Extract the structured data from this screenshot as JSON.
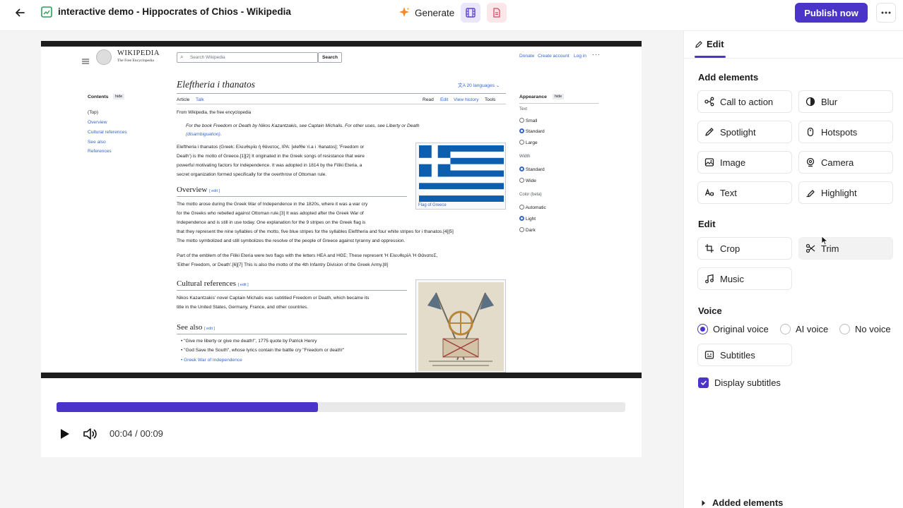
{
  "topbar": {
    "title": "interactive demo - Hippocrates of Chios - Wikipedia",
    "generate_label": "Generate",
    "publish_label": "Publish now",
    "accent": "#4b35c8"
  },
  "player": {
    "time": "00:04 / 00:09",
    "progress": 0.46
  },
  "panel": {
    "tab_label": "Edit",
    "add_elements_title": "Add elements",
    "add_elements": [
      {
        "label": "Call to action",
        "icon": "call-to-action-icon"
      },
      {
        "label": "Blur",
        "icon": "blur-icon"
      },
      {
        "label": "Spotlight",
        "icon": "spotlight-icon"
      },
      {
        "label": "Hotspots",
        "icon": "hotspots-icon"
      },
      {
        "label": "Image",
        "icon": "image-icon"
      },
      {
        "label": "Camera",
        "icon": "camera-icon"
      },
      {
        "label": "Text",
        "icon": "text-icon"
      },
      {
        "label": "Highlight",
        "icon": "highlight-icon"
      }
    ],
    "edit_title": "Edit",
    "edit_items": [
      {
        "label": "Crop",
        "icon": "crop-icon"
      },
      {
        "label": "Trim",
        "icon": "scissors-icon"
      },
      {
        "label": "Music",
        "icon": "music-icon"
      }
    ],
    "voice_title": "Voice",
    "voice_options": [
      "Original voice",
      "AI voice",
      "No voice"
    ],
    "voice_selected": "Original voice",
    "subtitles_label": "Subtitles",
    "display_subtitles_label": "Display subtitles",
    "display_subtitles_checked": true,
    "added_elements_label": "Added elements"
  },
  "wiki": {
    "logo_title": "WIKIPEDIA",
    "logo_sub": "The Free Encyclopedia",
    "search_placeholder": "Search Wikipedia",
    "search_button": "Search",
    "top_links": [
      "Donate",
      "Create account",
      "Log in"
    ],
    "contents_title": "Contents",
    "hide": "hide",
    "toc": [
      "(Top)",
      "Overview",
      "Cultural references",
      "See also",
      "References"
    ],
    "article_title": "Eleftheria i thanatos",
    "languages": "20 languages",
    "tabs_left": [
      "Article",
      "Talk"
    ],
    "tabs_right": [
      "Read",
      "Edit",
      "View history",
      "Tools"
    ],
    "from": "From Wikipedia, the free encyclopedia",
    "hatnote_1": "For the book Freedom or Death by Nikos Kazantzakis, see Captain Michalis. For other uses, see Liberty or Death",
    "hatnote_2": "(disambiguation).",
    "intro_lines": [
      "Eleftheria i thanatos (Greek: Ελευθερία ή θάνατος, IPA: [elefθeˈri.a i ˈθanatos]; 'Freedom or",
      "Death') is the motto of Greece.[1][2] It originated in the Greek songs of resistance that were",
      "powerful motivating factors for independence. It was adopted in 1814 by the Filiki Eteria, a",
      "secret organization formed specifically for the overthrow of Ottoman rule."
    ],
    "flag_caption": "Flag of Greece",
    "overview_h": "Overview",
    "edit_tag": "[ edit ]",
    "overview_lines": [
      "The motto arose during the Greek War of Independence in the 1820s, where it was a war cry",
      "for the Greeks who rebelled against Ottoman rule.[3] It was adopted after the Greek War of",
      "Independence and is still in use today. One explanation for the 9 stripes on the Greek flag is",
      "that they represent the nine syllables of the motto, five blue stripes for the syllables Eleftheria and four white stripes for i thanatos.[4][5]",
      "The motto symbolized and still symbolizes the resolve of the people of Greece against tyranny and oppression."
    ],
    "emblem_lines": [
      "Part of the emblem of the Filiki Eteria were two flags with the letters HEA and ΗΘΣ; These represent 'Η ΕλευθερίΑ 'Η ΘάνατοΣ,",
      "'Either Freedom, or Death'.[6][7] This is also the motto of the 4th Infantry Division of the Greek Army.[8]"
    ],
    "cultural_h": "Cultural references",
    "cultural_lines": [
      "Nikos Kazantzakis' novel Captain Michalis was subtitled Freedom or Death, which became its",
      "title in the United States, Germany, France, and other countries."
    ],
    "seealso_h": "See also",
    "seealso": [
      "\"Give me liberty or give me death!\", 1775 quote by Patrick Henry",
      "\"God Save the South\", whose lyrics contain the battle cry \"Freedom or death!\"",
      "Greek War of Independence"
    ],
    "appearance_title": "Appearance",
    "text_label": "Text",
    "text_opts": [
      "Small",
      "Standard",
      "Large"
    ],
    "width_label": "Width",
    "width_opts": [
      "Standard",
      "Wide"
    ],
    "color_label": "Color (beta)",
    "color_opts": [
      "Automatic",
      "Light",
      "Dark"
    ]
  }
}
